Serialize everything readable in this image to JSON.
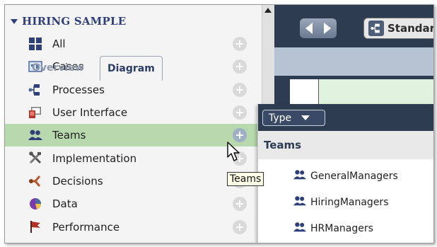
{
  "library": {
    "title": "HIRING SAMPLE",
    "items": [
      {
        "label": "All",
        "icon": "grid-icon",
        "active": false
      },
      {
        "label": "Cases",
        "icon": "case-icon",
        "active": false
      },
      {
        "label": "Processes",
        "icon": "process-icon",
        "active": false
      },
      {
        "label": "User Interface",
        "icon": "user-interface-icon",
        "active": false
      },
      {
        "label": "Teams",
        "icon": "teams-icon",
        "active": true
      },
      {
        "label": "Implementation",
        "icon": "tools-icon",
        "active": false
      },
      {
        "label": "Decisions",
        "icon": "decisions-icon",
        "active": false
      },
      {
        "label": "Data",
        "icon": "data-icon",
        "active": false
      },
      {
        "label": "Performance",
        "icon": "flag-icon",
        "active": false
      }
    ]
  },
  "editor": {
    "standard_button_label": "Standar",
    "tabs": [
      "Overview",
      "Diagram"
    ],
    "active_tab": "Diagram"
  },
  "popup": {
    "filter_label": "Type",
    "section_title": "Teams",
    "teams": [
      "GeneralManagers",
      "HiringManagers",
      "HRManagers"
    ]
  },
  "tooltip": {
    "text": "Teams"
  },
  "colors": {
    "active_row": "#b7d9ad",
    "header_text": "#2f3f7a",
    "toolbar_bg": "#2e3c52"
  }
}
